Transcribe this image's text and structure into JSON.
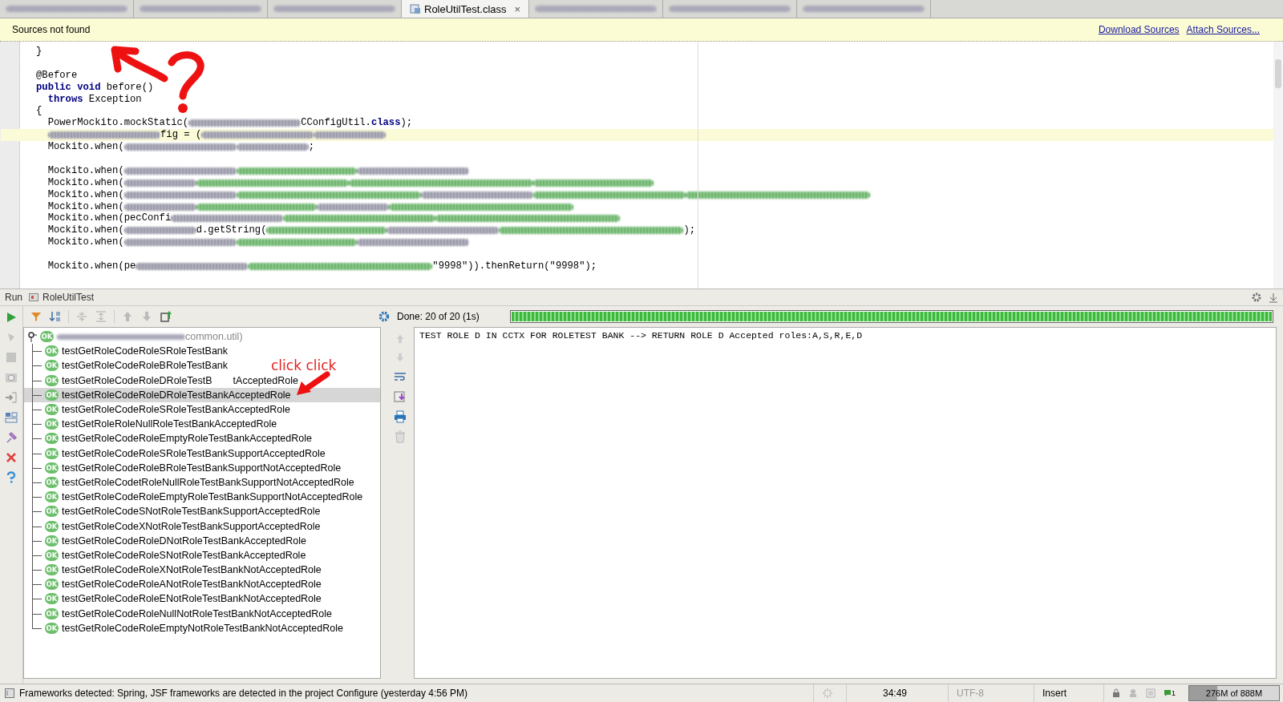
{
  "tabs": [
    {
      "kind": "blurred",
      "selected": false
    },
    {
      "kind": "blurred",
      "selected": false
    },
    {
      "kind": "blurred",
      "selected": false
    },
    {
      "kind": "file",
      "label": "RoleUtilTest.class",
      "close": "×",
      "selected": true
    },
    {
      "kind": "blurred",
      "selected": false
    },
    {
      "kind": "blurred",
      "selected": false
    },
    {
      "kind": "blurred",
      "selected": false
    }
  ],
  "banner": {
    "message": "Sources not found",
    "links": [
      "Download Sources",
      "Attach Sources..."
    ]
  },
  "code_lines": [
    {
      "highlighted": false,
      "segments": [
        {
          "kind": "text",
          "text": "}"
        }
      ]
    },
    {
      "highlighted": false
    },
    {
      "highlighted": false,
      "segments": [
        {
          "kind": "annotation",
          "text": "@Before"
        }
      ]
    },
    {
      "highlighted": false,
      "segments": [
        {
          "kind": "keyword",
          "text": "public void"
        },
        {
          "kind": "text",
          "text": " before()"
        }
      ]
    },
    {
      "highlighted": false,
      "segments": [
        {
          "kind": "keyword",
          "text": "  throws"
        },
        {
          "kind": "text",
          "text": " Exception"
        }
      ]
    },
    {
      "highlighted": false,
      "segments": [
        {
          "kind": "text",
          "text": "{"
        }
      ]
    },
    {
      "highlighted": false,
      "segments": [
        {
          "kind": "text",
          "text": "  PowerMockito.mockStatic("
        },
        {
          "kind": "blur-gray"
        },
        {
          "kind": "text",
          "text": "CConfigUtil."
        },
        {
          "kind": "keyword",
          "text": "class"
        },
        {
          "kind": "text",
          "text": ");"
        }
      ]
    },
    {
      "highlighted": true,
      "indent": true,
      "segments": [
        {
          "kind": "blur-gray"
        },
        {
          "kind": "text",
          "text": "fig = ("
        },
        {
          "kind": "blur-gray"
        },
        {
          "kind": "blur-gray"
        }
      ]
    },
    {
      "highlighted": false,
      "segments": [
        {
          "kind": "text",
          "text": "  Mockito.when("
        },
        {
          "kind": "blur-gray"
        },
        {
          "kind": "blur-gray"
        },
        {
          "kind": "text",
          "text": ";"
        }
      ]
    },
    {
      "highlighted": false
    },
    {
      "highlighted": false,
      "segments": [
        {
          "kind": "text",
          "text": "  Mockito.when("
        },
        {
          "kind": "blur-gray"
        },
        {
          "kind": "blur-green"
        },
        {
          "kind": "blur-gray"
        }
      ]
    },
    {
      "highlighted": false,
      "segments": [
        {
          "kind": "text",
          "text": "  Mockito.when("
        },
        {
          "kind": "blur-gray"
        },
        {
          "kind": "blur-green"
        },
        {
          "kind": "blur-green"
        },
        {
          "kind": "blur-green"
        }
      ]
    },
    {
      "highlighted": false,
      "segments": [
        {
          "kind": "text",
          "text": "  Mockito.when("
        },
        {
          "kind": "blur-gray"
        },
        {
          "kind": "blur-green"
        },
        {
          "kind": "blur-gray"
        },
        {
          "kind": "blur-green"
        },
        {
          "kind": "blur-green"
        }
      ]
    },
    {
      "highlighted": false,
      "segments": [
        {
          "kind": "text",
          "text": "  Mockito.when("
        },
        {
          "kind": "blur-gray"
        },
        {
          "kind": "blur-green"
        },
        {
          "kind": "blur-gray"
        },
        {
          "kind": "blur-green"
        }
      ]
    },
    {
      "highlighted": false,
      "segments": [
        {
          "kind": "text",
          "text": "  Mockito.when(pecConfi"
        },
        {
          "kind": "blur-gray"
        },
        {
          "kind": "blur-green"
        },
        {
          "kind": "blur-green"
        }
      ]
    },
    {
      "highlighted": false,
      "segments": [
        {
          "kind": "text",
          "text": "  Mockito.when("
        },
        {
          "kind": "blur-gray"
        },
        {
          "kind": "text",
          "text": "d.getString("
        },
        {
          "kind": "blur-green"
        },
        {
          "kind": "blur-gray"
        },
        {
          "kind": "blur-green"
        },
        {
          "kind": "text",
          "text": ");"
        }
      ]
    },
    {
      "highlighted": false,
      "segments": [
        {
          "kind": "text",
          "text": "  Mockito.when("
        },
        {
          "kind": "blur-gray"
        },
        {
          "kind": "blur-green"
        },
        {
          "kind": "blur-gray"
        }
      ]
    },
    {
      "highlighted": false
    },
    {
      "highlighted": false,
      "segments": [
        {
          "kind": "text",
          "text": "  Mockito.when(pe"
        },
        {
          "kind": "blur-gray"
        },
        {
          "kind": "blur-green"
        },
        {
          "kind": "text",
          "text": "\"9998\")).thenReturn(\"9998\");"
        }
      ]
    }
  ],
  "run_panel": {
    "label": "Run",
    "config": "RoleUtilTest",
    "status": "Done: 20 of 20 (1s)",
    "progress": {
      "level": 1.0
    },
    "tree": {
      "root": {
        "label": "common.util)",
        "status": "OK",
        "children": [
          {
            "label": "testGetRoleCodeRoleSRoleTestBank",
            "status": "OK",
            "selected": false
          },
          {
            "label": "testGetRoleCodeRoleBRoleTestBank",
            "status": "OK",
            "selected": false
          },
          {
            "label": "testGetRoleCodeRoleDRoleTestB",
            "status": "OK",
            "selected": false,
            "tail": "tAcceptedRole"
          },
          {
            "label": "testGetRoleCodeRoleDRoleTestBankAcceptedRole",
            "status": "OK",
            "selected": true
          },
          {
            "label": "testGetRoleCodeRoleSRoleTestBankAcceptedRole",
            "status": "OK",
            "selected": false
          },
          {
            "label": "testGetRoleRoleNullRoleTestBankAcceptedRole",
            "status": "OK",
            "selected": false
          },
          {
            "label": "testGetRoleCodeRoleEmptyRoleTestBankAcceptedRole",
            "status": "OK",
            "selected": false
          },
          {
            "label": "testGetRoleCodeRoleSRoleTestBankSupportAcceptedRole",
            "status": "OK",
            "selected": false
          },
          {
            "label": "testGetRoleCodeRoleBRoleTestBankSupportNotAcceptedRole",
            "status": "OK",
            "selected": false
          },
          {
            "label": "testGetRoleCodetRoleNullRoleTestBankSupportNotAcceptedRole",
            "status": "OK",
            "selected": false
          },
          {
            "label": "testGetRoleCodeRoleEmptyRoleTestBankSupportNotAcceptedRole",
            "status": "OK",
            "selected": false
          },
          {
            "label": "testGetRoleCodeSNotRoleTestBankSupportAcceptedRole",
            "status": "OK",
            "selected": false
          },
          {
            "label": "testGetRoleCodeXNotRoleTestBankSupportAcceptedRole",
            "status": "OK",
            "selected": false
          },
          {
            "label": "testGetRoleCodeRoleDNotRoleTestBankAcceptedRole",
            "status": "OK",
            "selected": false
          },
          {
            "label": "testGetRoleCodeRoleSNotRoleTestBankAcceptedRole",
            "status": "OK",
            "selected": false
          },
          {
            "label": "testGetRoleCodeRoleXNotRoleTestBankNotAcceptedRole",
            "status": "OK",
            "selected": false
          },
          {
            "label": "testGetRoleCodeRoleANotRoleTestBankNotAcceptedRole",
            "status": "OK",
            "selected": false
          },
          {
            "label": "testGetRoleCodeRoleENotRoleTestBankNotAcceptedRole",
            "status": "OK",
            "selected": false
          },
          {
            "label": "testGetRoleCodeRoleNullNotRoleTestBankNotAcceptedRole",
            "status": "OK",
            "selected": false
          },
          {
            "label": "testGetRoleCodeRoleEmptyNotRoleTestBankNotAcceptedRole",
            "status": "OK",
            "selected": false
          }
        ]
      }
    },
    "console": [
      "TEST ROLE D IN CCTX FOR ROLETEST BANK --> RETURN ROLE D Accepted roles:A,S,R,E,D"
    ]
  },
  "annotations": {
    "note": "click click"
  },
  "status_bar": {
    "message": "Frameworks detected: Spring, JSF frameworks are detected in the project Configure (yesterday 4:56 PM)",
    "position": "34:49",
    "encoding": "UTF-8",
    "mode": "Insert",
    "events": "1",
    "memory": {
      "text": "276M of 888M",
      "level": 0.31
    }
  }
}
